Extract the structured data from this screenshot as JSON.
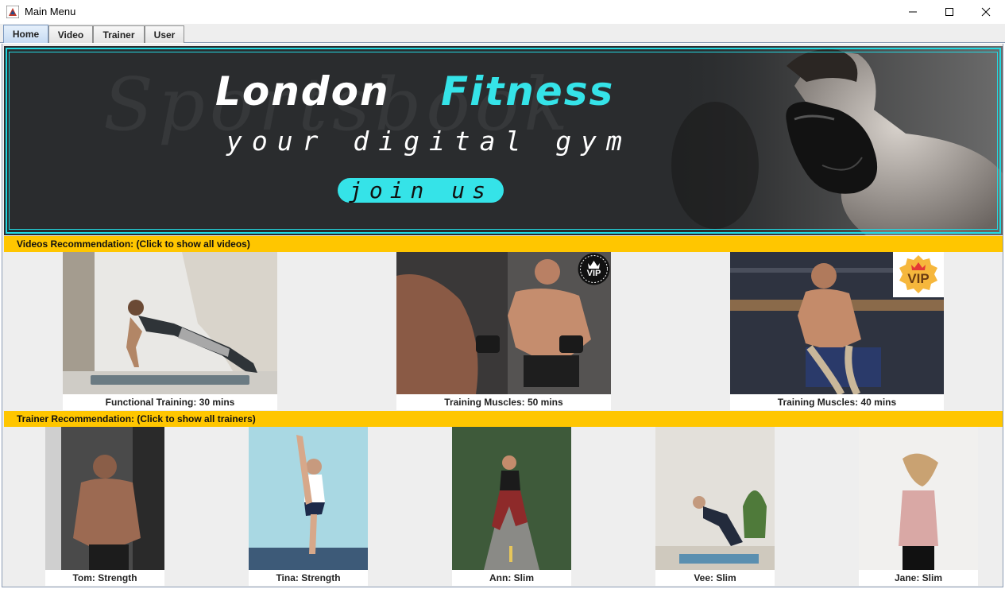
{
  "window": {
    "title": "Main Menu"
  },
  "tabs": [
    {
      "label": "Home",
      "active": true
    },
    {
      "label": "Video",
      "active": false
    },
    {
      "label": "Trainer",
      "active": false
    },
    {
      "label": "User",
      "active": false
    }
  ],
  "banner": {
    "scribble": "Sportsbook",
    "title_part1": "London",
    "title_part2": "Fitness",
    "subtitle": "your digital gym",
    "cta": "join us",
    "accent_color": "#35e3e8"
  },
  "videos_section": {
    "header": "Videos Recommendation: (Click to show all videos)",
    "items": [
      {
        "caption": "Functional Training: 30 mins",
        "vip": false
      },
      {
        "caption": "Training Muscles: 50 mins",
        "vip": true,
        "vip_label": "VIP"
      },
      {
        "caption": "Training Muscles: 40 mins",
        "vip": true,
        "vip_label": "VIP"
      }
    ]
  },
  "trainers_section": {
    "header": "Trainer Recommendation: (Click to show all trainers)",
    "items": [
      {
        "caption": "Tom: Strength"
      },
      {
        "caption": "Tina: Strength"
      },
      {
        "caption": "Ann: Slim"
      },
      {
        "caption": "Vee: Slim"
      },
      {
        "caption": "Jane: Slim"
      }
    ]
  },
  "colors": {
    "section_header": "#ffc600",
    "banner_background": "#2a2c2e",
    "banner_accent": "#22d9e2"
  }
}
